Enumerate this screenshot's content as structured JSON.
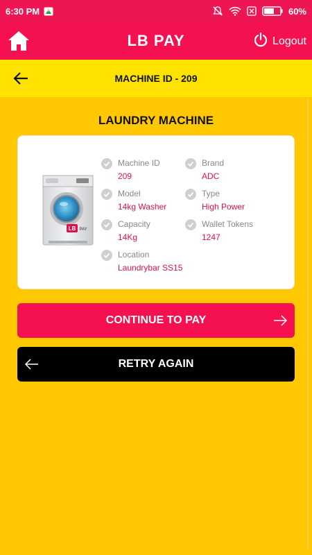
{
  "status_bar": {
    "time": "6:30 PM",
    "battery": "60%",
    "icons": [
      "drive-icon",
      "mute-icon",
      "wifi-icon",
      "sim-icon",
      "battery-icon"
    ]
  },
  "header": {
    "title": "LB PAY",
    "logout_label": "Logout",
    "home_icon": "home-icon",
    "power_icon": "power-icon"
  },
  "subheader": {
    "title": "MACHINE ID - 209",
    "back_icon": "arrow-left-icon"
  },
  "machine": {
    "heading": "LAUNDRY MACHINE",
    "fields": [
      {
        "label": "Machine ID",
        "value": "209"
      },
      {
        "label": "Brand",
        "value": "ADC"
      },
      {
        "label": "Model",
        "value": "14kg Washer"
      },
      {
        "label": "Type",
        "value": "High Power"
      },
      {
        "label": "Capacity",
        "value": "14Kg"
      },
      {
        "label": "Wallet Tokens",
        "value": "1247"
      },
      {
        "label": "Location",
        "value": "Laundrybar SS15"
      }
    ],
    "image_logo": "LB PAY"
  },
  "actions": {
    "continue_label": "CONTINUE TO PAY",
    "retry_label": "RETRY AGAIN"
  },
  "colors": {
    "primary": "#f5104f",
    "accent_yellow": "#ffe200",
    "background": "#ffc800"
  }
}
